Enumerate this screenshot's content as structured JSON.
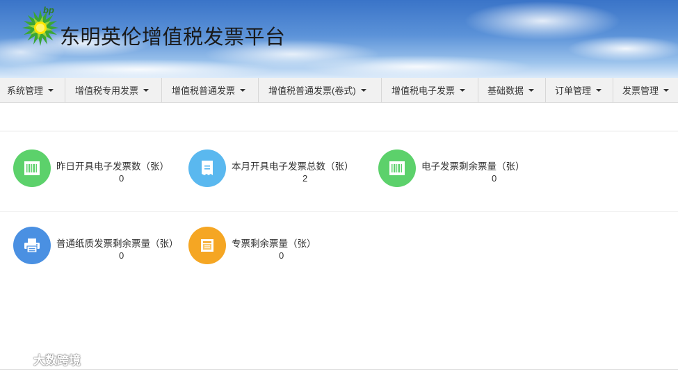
{
  "header": {
    "logo_text": "bp",
    "title": "东明英伦增值税发票平台"
  },
  "nav": [
    {
      "label": "系统管理"
    },
    {
      "label": "增值税专用发票"
    },
    {
      "label": "增值税普通发票"
    },
    {
      "label": "增值税普通发票(卷式)"
    },
    {
      "label": "增值税电子发票"
    },
    {
      "label": "基础数据"
    },
    {
      "label": "订单管理"
    },
    {
      "label": "发票管理"
    }
  ],
  "stats_row1": [
    {
      "label": "昨日开具电子发票数（张）",
      "value": "0",
      "icon": "barcode-icon",
      "color": "#5cd16b"
    },
    {
      "label": "本月开具电子发票总数（张）",
      "value": "2",
      "icon": "receipt-icon",
      "color": "#5ab8ef"
    },
    {
      "label": "电子发票剩余票量（张）",
      "value": "0",
      "icon": "barcode-icon",
      "color": "#5cd16b"
    }
  ],
  "stats_row2": [
    {
      "label": "普通纸质发票剩余票量（张）",
      "value": "0",
      "icon": "printer-icon",
      "color": "#4a90e2"
    },
    {
      "label": "专票剩余票量（张）",
      "value": "0",
      "icon": "ticket-icon",
      "color": "#f5a623"
    }
  ],
  "watermark": "大数跨境",
  "colors": {
    "green": "#5cd16b",
    "light_blue": "#5ab8ef",
    "blue": "#4a90e2",
    "orange": "#f5a623"
  }
}
